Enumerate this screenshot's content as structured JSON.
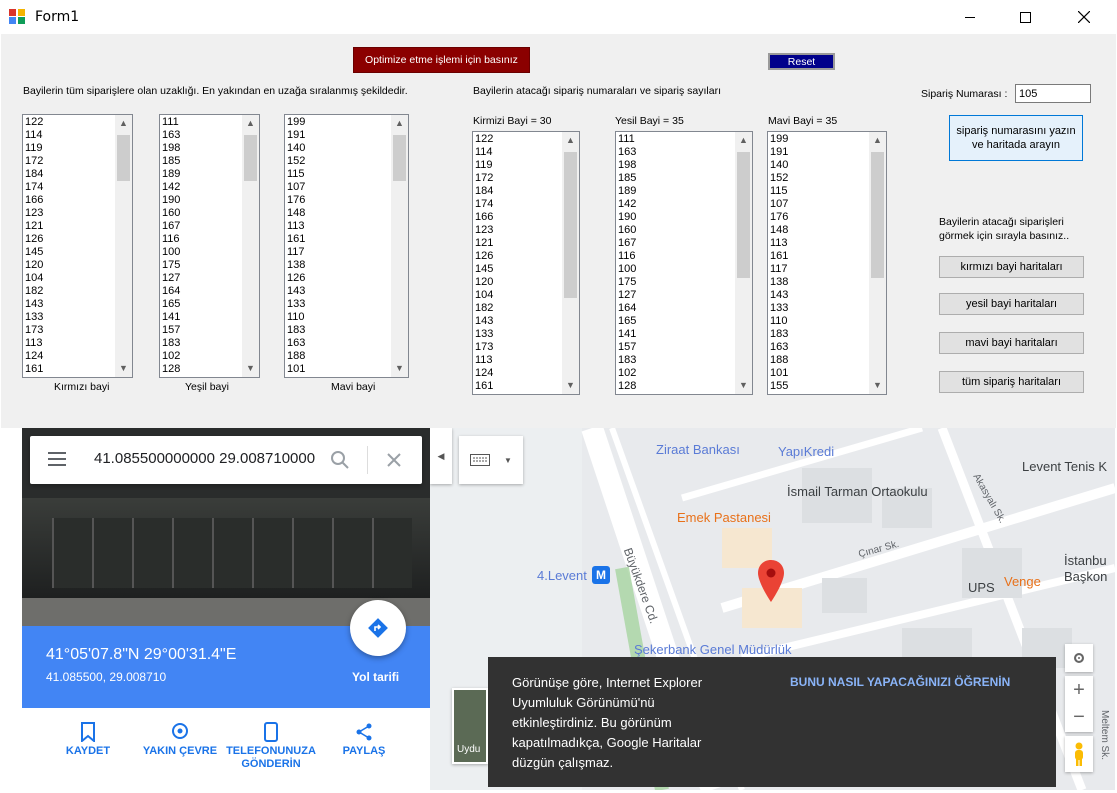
{
  "window": {
    "title": "Form1"
  },
  "buttons": {
    "optimize": "Optimize etme işlemi için basınız",
    "reset": "Reset",
    "search_order": "sipariş numarasını yazın ve haritada arayın",
    "red_map": "kırmızı bayi haritaları",
    "green_map": "yesil bayi haritaları",
    "blue_map": "mavi bayi haritaları",
    "all_map": "tüm sipariş haritaları"
  },
  "labels": {
    "distances": "Bayilerin tüm siparişlere olan uzaklığı. En yakından en uzağa sıralanmış şekildedir.",
    "assigned": "Bayilerin atacağı sipariş numaraları ve sipariş sayıları",
    "order_no": "Sipariş Numarası :",
    "red": "Kırmızı bayi",
    "green": "Yeşil bayi",
    "blue": "Mavi bayi",
    "red_count": "Kirmizi Bayi = 30",
    "green_count": "Yesil Bayi = 35",
    "blue_count": "Mavi Bayi = 35",
    "hint": "Bayilerin atacağı siparişleri görmek için sırayla basınız.."
  },
  "order_input": {
    "value": "105"
  },
  "lists": {
    "red": [
      "122",
      "114",
      "119",
      "172",
      "184",
      "174",
      "166",
      "123",
      "121",
      "126",
      "145",
      "120",
      "104",
      "182",
      "143",
      "133",
      "173",
      "113",
      "124",
      "161"
    ],
    "green": [
      "111",
      "163",
      "198",
      "185",
      "189",
      "142",
      "190",
      "160",
      "167",
      "116",
      "100",
      "175",
      "127",
      "164",
      "165",
      "141",
      "157",
      "183",
      "102",
      "128"
    ],
    "blue": [
      "199",
      "191",
      "140",
      "152",
      "115",
      "107",
      "176",
      "148",
      "113",
      "161",
      "117",
      "138",
      "126",
      "143",
      "133",
      "110",
      "183",
      "163",
      "188",
      "101"
    ],
    "red_assigned": [
      "122",
      "114",
      "119",
      "172",
      "184",
      "174",
      "166",
      "123",
      "121",
      "126",
      "145",
      "120",
      "104",
      "182",
      "143",
      "133",
      "173",
      "113",
      "124",
      "161"
    ],
    "green_assigned": [
      "111",
      "163",
      "198",
      "185",
      "189",
      "142",
      "190",
      "160",
      "167",
      "116",
      "100",
      "175",
      "127",
      "164",
      "165",
      "141",
      "157",
      "183",
      "102",
      "128"
    ],
    "blue_assigned": [
      "199",
      "191",
      "140",
      "152",
      "115",
      "107",
      "176",
      "148",
      "113",
      "161",
      "117",
      "138",
      "143",
      "133",
      "110",
      "183",
      "163",
      "188",
      "101",
      "155"
    ]
  },
  "map": {
    "search_value": "41.085500000000 29.008710000",
    "coords_dms": "41°05'07.8\"N 29°00'31.4\"E",
    "coords_dec": "41.085500, 29.008710",
    "directions": "Yol tarifi",
    "actions": [
      "KAYDET",
      "YAKIN ÇEVRE",
      "TELEFONUNUZA GÖNDERİN",
      "PAYLAŞ"
    ],
    "poi": {
      "ziraat": "Ziraat Bankası",
      "yapikredi": "YapıKredi",
      "levent_tenis": "Levent Tenis K",
      "ismail": "İsmail Tarman Ortaokulu",
      "emek": "Emek Pastanesi",
      "buyukdere": "Büyükdere Cd.",
      "cinar": "Çınar Sk.",
      "akasyali": "Akasyalı Sk.",
      "levent4": "4.Levent",
      "ups": "UPS",
      "venge": "Venge",
      "istanbul": "İstanbu Başkon",
      "sekerbank": "Şekerbank Genel Müdürlük",
      "meltem": "Meltem Sk.",
      "uydu": "Uydu"
    },
    "toast_text": "Görünüşe göre, Internet Explorer Uyumluluk Görünümü'nü etkinleştirdiniz. Bu görünüm kapatılmadıkça, Google Haritalar düzgün çalışmaz.",
    "toast_link": "BUNU NASIL YAPACAĞINIZI ÖĞRENİN"
  }
}
